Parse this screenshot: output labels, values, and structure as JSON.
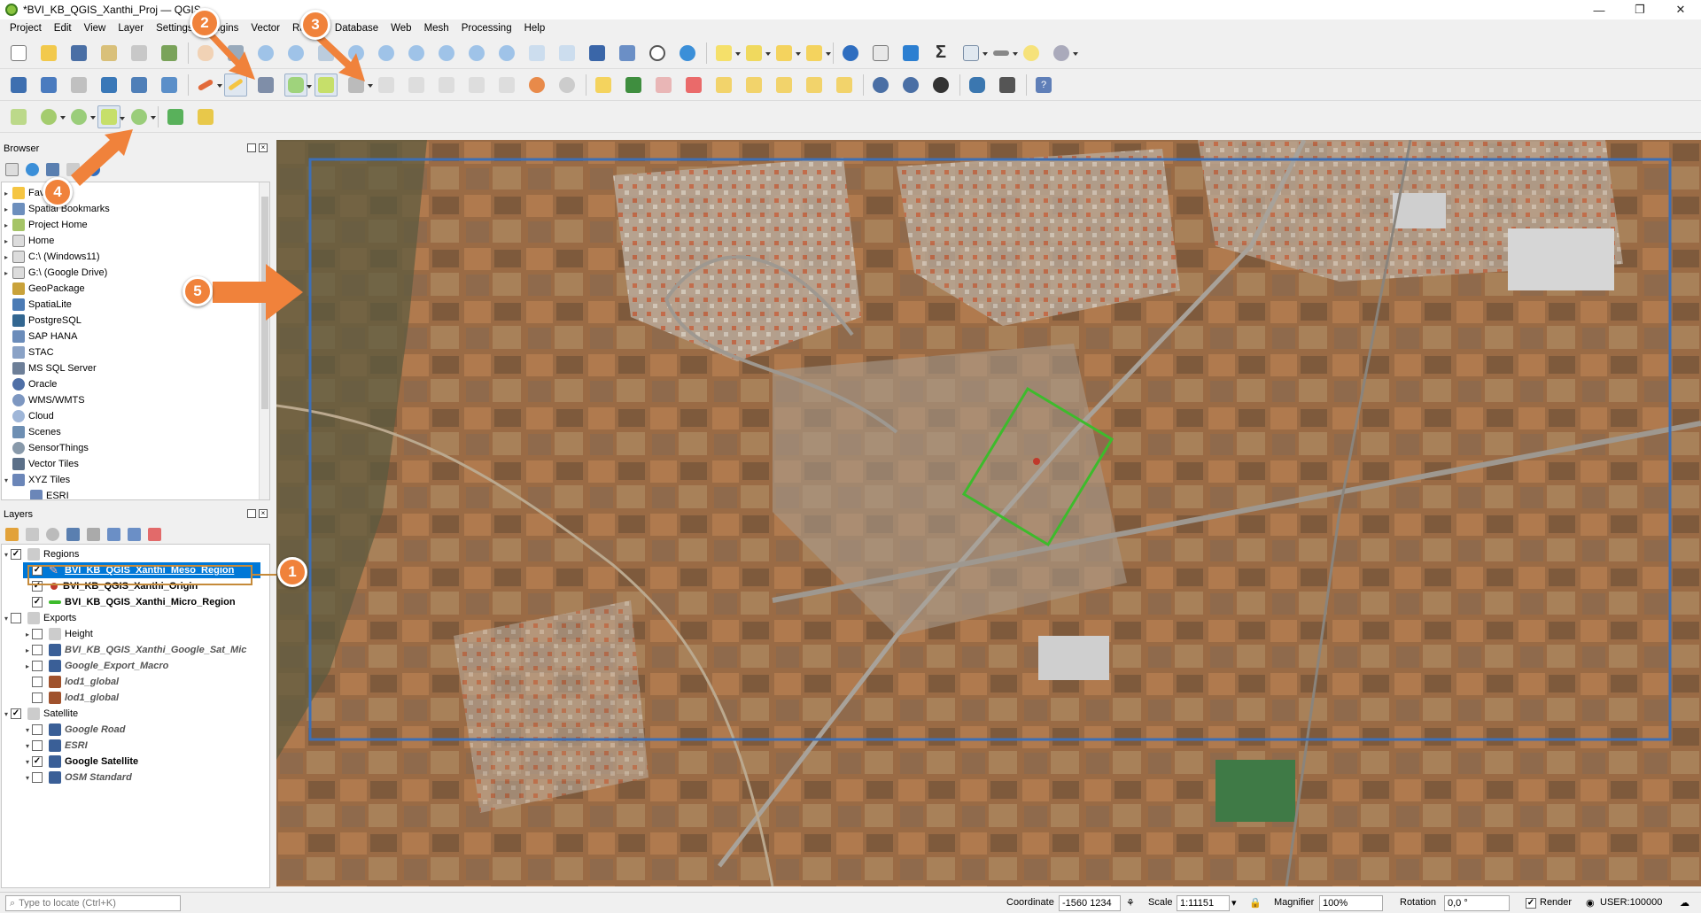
{
  "window": {
    "title": "*BVI_KB_QGIS_Xanthi_Proj — QGIS",
    "minimize": "—",
    "maximize": "❐",
    "close": "✕"
  },
  "menu": [
    "Project",
    "Edit",
    "View",
    "Layer",
    "Settings",
    "Plugins",
    "Vector",
    "Raster",
    "Database",
    "Web",
    "Mesh",
    "Processing",
    "Help"
  ],
  "browser": {
    "title": "Browser",
    "items": [
      {
        "label": "Favorites",
        "icon": "star-icon"
      },
      {
        "label": "Spatial Bookmarks",
        "icon": "bookmark-icon"
      },
      {
        "label": "Project Home",
        "icon": "project-home-icon"
      },
      {
        "label": "Home",
        "icon": "home-folder-icon"
      },
      {
        "label": "C:\\ (Windows11)",
        "icon": "drive-icon"
      },
      {
        "label": "G:\\ (Google Drive)",
        "icon": "drive-icon"
      },
      {
        "label": "GeoPackage",
        "icon": "geopackage-icon"
      },
      {
        "label": "SpatiaLite",
        "icon": "spatialite-icon"
      },
      {
        "label": "PostgreSQL",
        "icon": "postgresql-icon"
      },
      {
        "label": "SAP HANA",
        "icon": "sap-hana-icon"
      },
      {
        "label": "STAC",
        "icon": "stac-icon"
      },
      {
        "label": "MS SQL Server",
        "icon": "mssql-icon"
      },
      {
        "label": "Oracle",
        "icon": "oracle-icon"
      },
      {
        "label": "WMS/WMTS",
        "icon": "wms-icon"
      },
      {
        "label": "Cloud",
        "icon": "cloud-icon"
      },
      {
        "label": "Scenes",
        "icon": "scenes-icon"
      },
      {
        "label": "SensorThings",
        "icon": "sensorthings-icon"
      },
      {
        "label": "Vector Tiles",
        "icon": "vector-tiles-icon"
      },
      {
        "label": "XYZ Tiles",
        "icon": "xyz-tiles-icon"
      },
      {
        "label": "ESRI",
        "icon": "xyz-layer-icon"
      }
    ]
  },
  "layers": {
    "title": "Layers",
    "groups": [
      {
        "name": "Regions",
        "checked": true,
        "children": [
          {
            "name": "BVI_KB_QGIS_Xanthi_Meso_Region",
            "checked": true,
            "selected": true,
            "style": "bold"
          },
          {
            "name": "BVI_KB_QGIS_Xanthi_Origin",
            "checked": true,
            "style": "bold"
          },
          {
            "name": "BVI_KB_QGIS_Xanthi_Micro_Region",
            "checked": true,
            "style": "bold"
          }
        ]
      },
      {
        "name": "Exports",
        "checked": false,
        "children": [
          {
            "name": "Height",
            "checked": false,
            "style": "normal"
          },
          {
            "name": "BVI_KB_QGIS_Xanthi_Google_Sat_Mic",
            "checked": false,
            "style": "italic"
          },
          {
            "name": "Google_Export_Macro",
            "checked": false,
            "style": "italic"
          },
          {
            "name": "lod1_global",
            "checked": false,
            "style": "italic"
          },
          {
            "name": "lod1_global",
            "checked": false,
            "style": "italic"
          }
        ]
      },
      {
        "name": "Satellite",
        "checked": true,
        "children": [
          {
            "name": "Google Road",
            "checked": false,
            "style": "italic"
          },
          {
            "name": "ESRI",
            "checked": false,
            "style": "italic"
          },
          {
            "name": "Google Satellite",
            "checked": true,
            "style": "bold"
          },
          {
            "name": "OSM Standard",
            "checked": false,
            "style": "italic"
          }
        ]
      }
    ]
  },
  "annotations": [
    "1",
    "2",
    "3",
    "4",
    "5"
  ],
  "status": {
    "locate_placeholder": "Type to locate (Ctrl+K)",
    "coordinate_label": "Coordinate",
    "coordinate_value": "-1560  1234",
    "scale_label": "Scale",
    "scale_value": "1:11151",
    "magnifier_label": "Magnifier",
    "magnifier_value": "100%",
    "rotation_label": "Rotation",
    "rotation_value": "0,0 °",
    "render_label": "Render",
    "crs_label": "USER:100000"
  },
  "colors": {
    "selection": "#0078d7",
    "meso_frame": "#3d6fb5",
    "micro_frame": "#3dbb2c",
    "badge": "#f0823b"
  }
}
